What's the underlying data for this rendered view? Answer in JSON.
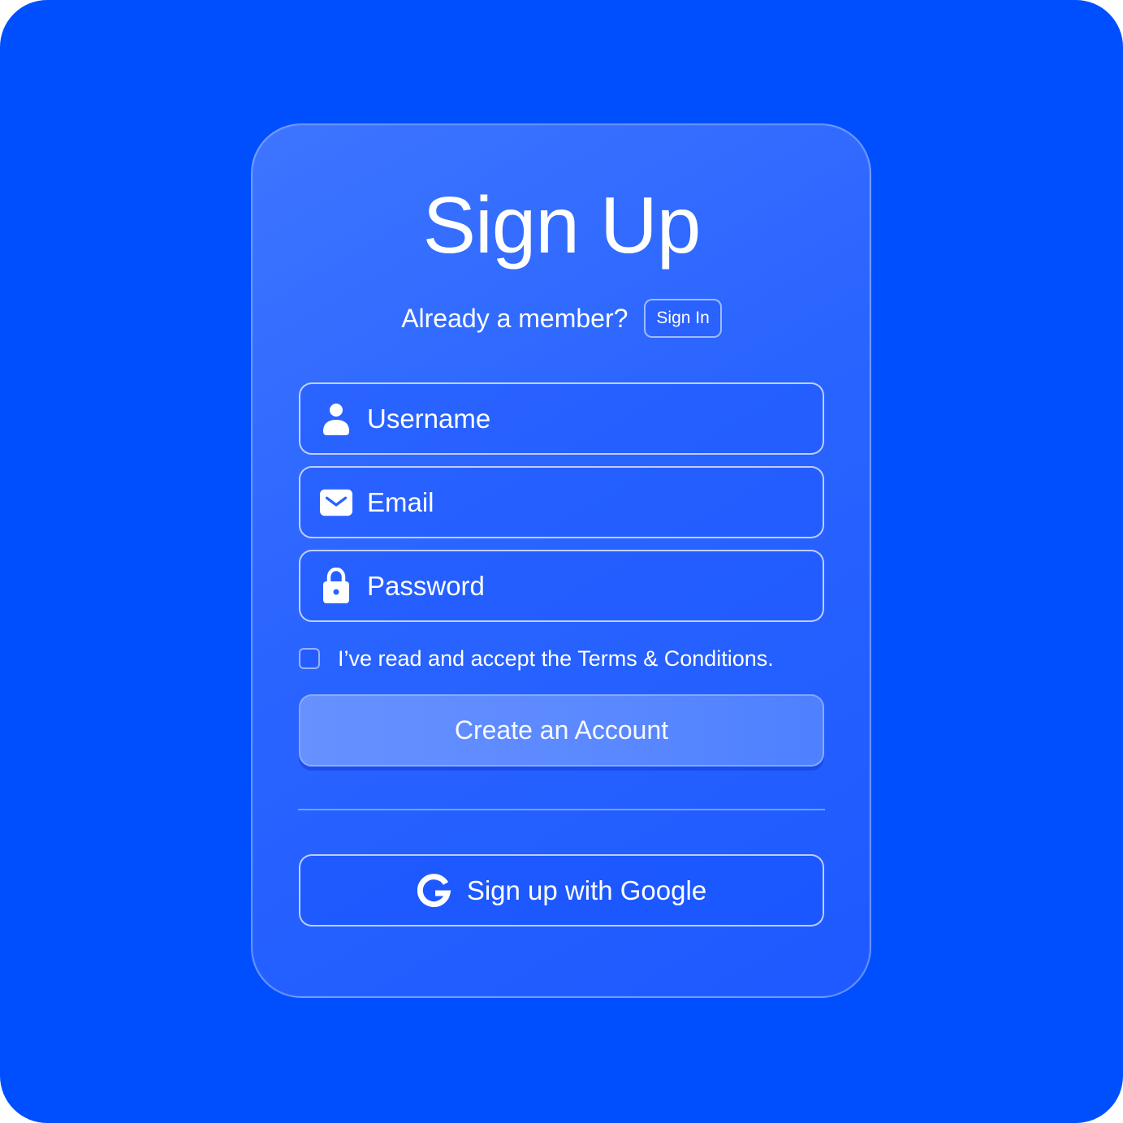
{
  "page": {
    "title": "Sign Up",
    "background_color": "#004fff"
  },
  "member_prompt": {
    "text": "Already a member?",
    "sign_in_label": "Sign In"
  },
  "form": {
    "username": {
      "placeholder": "Username",
      "value": "",
      "icon": "user-icon"
    },
    "email": {
      "placeholder": "Email",
      "value": "",
      "icon": "mail-icon"
    },
    "password": {
      "placeholder": "Password",
      "value": "",
      "icon": "lock-icon"
    },
    "terms": {
      "label": "I’ve read and accept the Terms & Conditions.",
      "checked": false
    },
    "create_account_label": "Create an Account"
  },
  "google": {
    "label": "Sign up with Google",
    "icon": "google-icon"
  }
}
